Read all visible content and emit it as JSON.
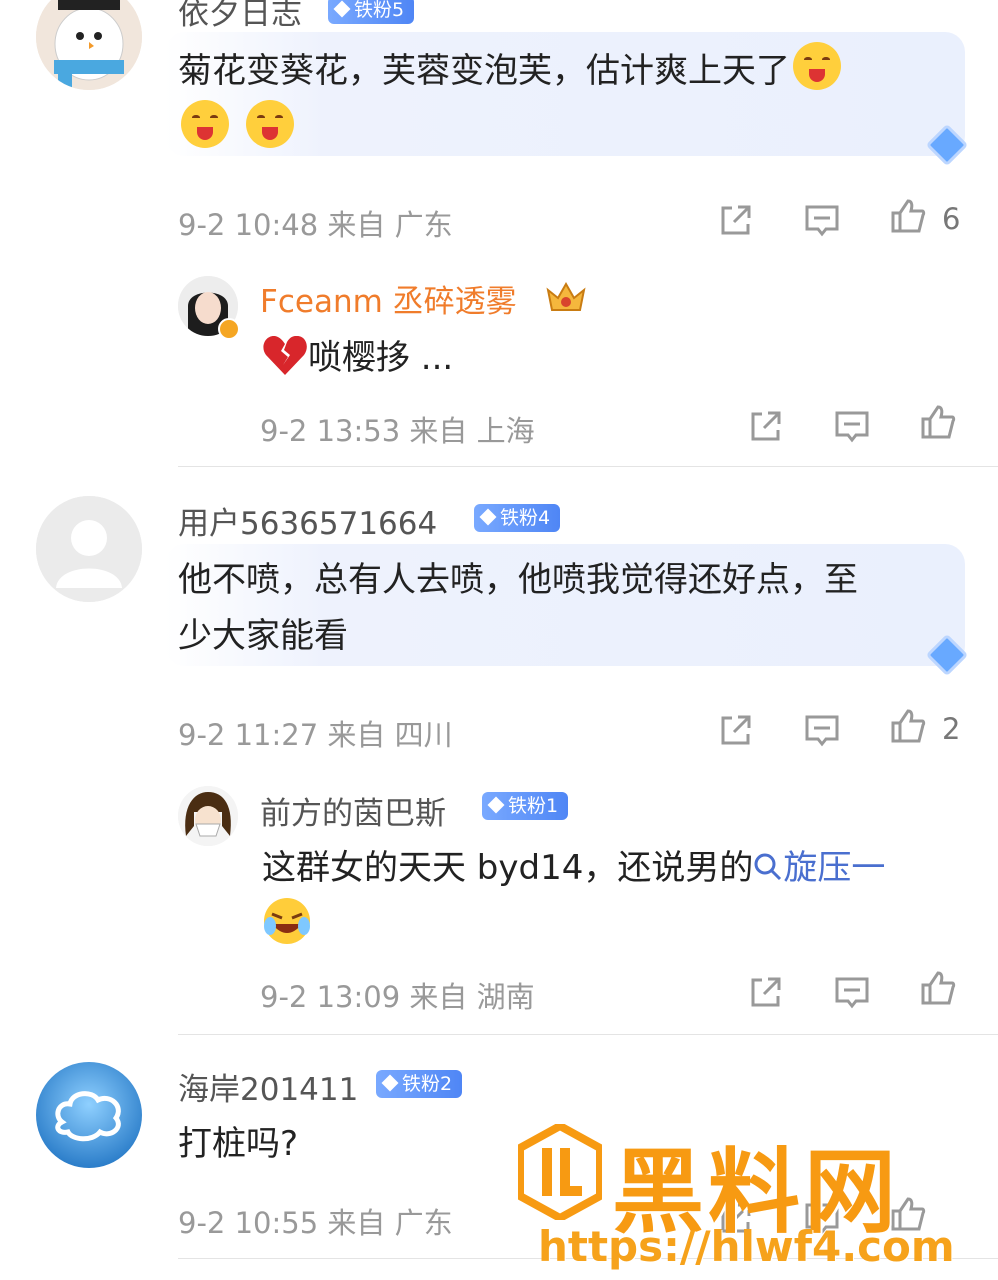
{
  "comments": [
    {
      "user": "依夕日志",
      "badge": "铁粉5",
      "text_line1": "菊花变葵花，芙蓉变泡芙，估计爽上天了",
      "time": "9-2 10:48",
      "from": "来自 广东",
      "likes": "6"
    },
    {
      "user": "Fceanm 丞碎透雾",
      "text": "唢樱拸 ...",
      "time": "9-2 13:53",
      "from": "来自 上海"
    },
    {
      "user": "用户5636571664",
      "badge": "铁粉4",
      "text_line1": "他不喷，总有人去喷，他喷我觉得还好点，至",
      "text_line2": "少大家能看",
      "time": "9-2 11:27",
      "from": "来自 四川",
      "likes": "2"
    },
    {
      "user": "前方的茵巴斯",
      "badge": "铁粉1",
      "text_line1": "这群女的天天 byd14，还说男的",
      "search_link": "旋压一",
      "time": "9-2 13:09",
      "from": "来自 湖南"
    },
    {
      "user": "海岸201411",
      "badge": "铁粉2",
      "text": "打桩吗?",
      "time": "9-2 10:55",
      "from": "来自 广东"
    }
  ],
  "watermark": {
    "title": "黑料网",
    "url": "https://hlwf4.com"
  },
  "colors": {
    "accent": "#4f86f5",
    "orange": "#f07c2b",
    "watermark": "#f79a12"
  },
  "icons": [
    "share-icon",
    "comment-icon",
    "like-icon",
    "search-icon",
    "broken-heart-icon",
    "crown-icon"
  ]
}
